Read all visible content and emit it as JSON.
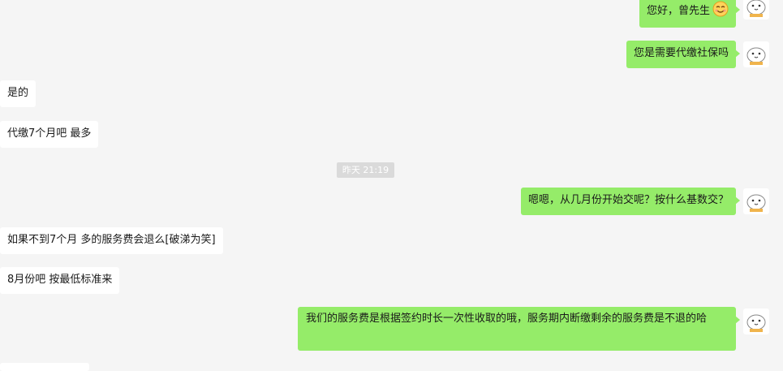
{
  "messages": [
    {
      "side": "out",
      "text": "您好，曾先生",
      "emoji": "smile-emoji"
    },
    {
      "side": "out",
      "text": "您是需要代缴社保吗"
    },
    {
      "side": "in",
      "text": "是的"
    },
    {
      "side": "in",
      "text": "代缴7个月吧 最多"
    },
    {
      "side": "out",
      "text": "嗯嗯，从几月份开始交呢？按什么基数交？"
    },
    {
      "side": "in",
      "text": "如果不到7个月  多的服务费会退么[破涕为笑]"
    },
    {
      "side": "in",
      "text": "8月份吧  按最低标准来"
    },
    {
      "side": "out",
      "text": "我们的服务费是根据签约时长一次性收取的哦，服务期内断缴剩余的服务费是不退的哈"
    }
  ],
  "timestamp": "昨天 21:19",
  "colors": {
    "out_bubble": "#95ec69",
    "in_bubble": "#ffffff",
    "background": "#f5f5f5"
  }
}
